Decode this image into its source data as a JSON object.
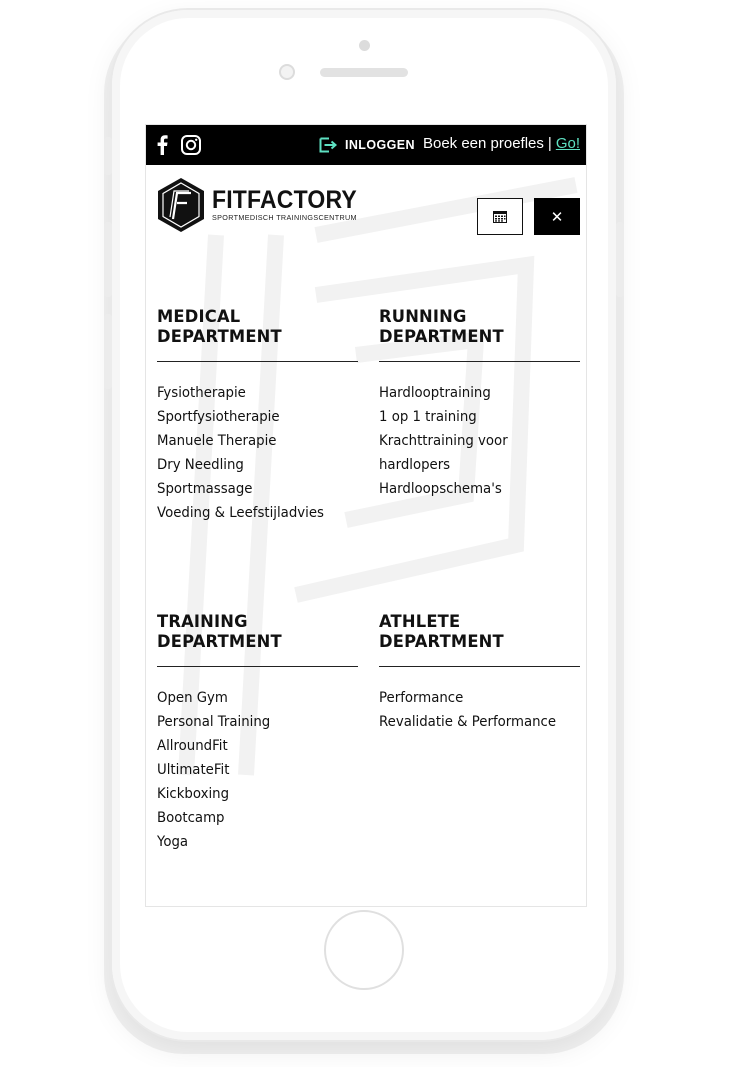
{
  "topbar": {
    "facebook_icon": "facebook-icon",
    "instagram_icon": "instagram-icon",
    "login_icon": "login-arrow-icon",
    "login_label": "INLOGGEN",
    "promo_text": "Boek een proefles",
    "promo_separator": "|",
    "promo_link": "Go!",
    "login_icon_color": "#5ee1c2"
  },
  "header": {
    "logo_name": "FITFACTORY",
    "logo_tagline": "SPORTMEDISCH TRAININGSCENTRUM",
    "calendar_icon": "calendar-icon",
    "close_label": "✕"
  },
  "departments": [
    {
      "title_line1": "MEDICAL",
      "title_line2": "DEPARTMENT",
      "items": [
        "Fysiotherapie",
        "Sportfysiotherapie",
        "Manuele Therapie",
        "Dry Needling",
        "Sportmassage",
        "Voeding & Leefstijladvies"
      ]
    },
    {
      "title_line1": "RUNNING",
      "title_line2": "DEPARTMENT",
      "items": [
        "Hardlooptraining",
        "1 op 1 training",
        "Krachttraining voor",
        "hardlopers",
        "Hardloopschema's"
      ]
    },
    {
      "title_line1": "TRAINING",
      "title_line2": "DEPARTMENT",
      "items": [
        "Open Gym",
        "Personal Training",
        "AllroundFit",
        "UltimateFit",
        "Kickboxing",
        "Bootcamp",
        "Yoga"
      ]
    },
    {
      "title_line1": "ATHLETE",
      "title_line2": "DEPARTMENT",
      "items": [
        "Performance",
        "Revalidatie & Performance"
      ]
    }
  ]
}
